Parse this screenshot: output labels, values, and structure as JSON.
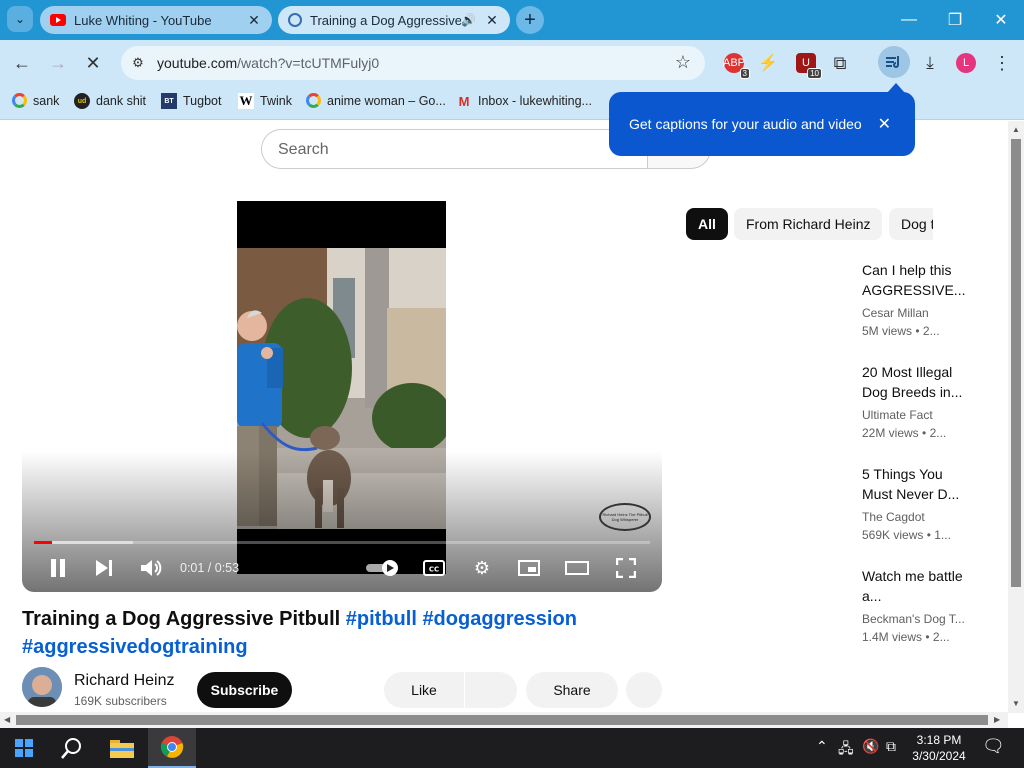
{
  "browser": {
    "tabs": [
      {
        "label": "Luke Whiting - YouTube"
      },
      {
        "label": "Training a Dog Aggressive Pitbull"
      }
    ],
    "url_host": "youtube.com",
    "url_path": "/watch?v=tcUTMFulyj0",
    "profile_initial": "L",
    "extensions": [
      {
        "name": "adblock-extension",
        "badge": "3"
      },
      {
        "name": "lightning-extension",
        "badge": ""
      },
      {
        "name": "shield-extension",
        "badge": "10"
      }
    ],
    "bookmarks": [
      {
        "label": "sank",
        "icon": "google-icon"
      },
      {
        "label": "dank shit",
        "icon": "ud-icon",
        "glyph": "ud"
      },
      {
        "label": "Tugbot",
        "icon": "bt-icon",
        "glyph": "BT"
      },
      {
        "label": "Twink",
        "icon": "w-icon",
        "glyph": "W"
      },
      {
        "label": "anime woman – Go...",
        "icon": "google-icon"
      },
      {
        "label": "Inbox - lukewhiting...",
        "icon": "gmail-icon",
        "glyph": "M"
      }
    ],
    "caption_popup": "Get captions for your audio and video"
  },
  "youtube": {
    "search_placeholder": "Search",
    "player": {
      "current_time": "0:01",
      "duration": "0:53",
      "time_display": "0:01 / 0:53",
      "progress_fraction": 0.03,
      "buffered_fraction": 0.16,
      "watermark": "Richard Heinz The Pitbull Dog Whisperer"
    },
    "video": {
      "title": "Training a Dog Aggressive Pitbull",
      "hashtags": [
        "#pitbull",
        "#dogaggression",
        "#aggressivedogtraining"
      ]
    },
    "channel": {
      "name": "Richard Heinz",
      "subscribers": "169K subscribers",
      "subscribe_label": "Subscribe"
    },
    "actions": {
      "like": "Like",
      "share": "Share"
    },
    "chips": [
      "All",
      "From Richard Heinz",
      "Dog t"
    ],
    "recommendations": [
      {
        "title": "Can I help this AGGRESSIVE...",
        "channel": "Cesar Millan",
        "views": "5M views",
        "age": "• 2..."
      },
      {
        "title": "20 Most Illegal Dog Breeds in...",
        "channel": "Ultimate Fact",
        "views": "22M views",
        "age": "• 2..."
      },
      {
        "title": "5 Things You Must Never D...",
        "channel": "The Cagdot",
        "views": "569K views",
        "age": "• 1..."
      },
      {
        "title": "Watch me battle a...",
        "channel": "Beckman's Dog T...",
        "views": "1.4M views",
        "age": "• 2..."
      }
    ]
  },
  "taskbar": {
    "time": "3:18 PM",
    "date": "3/30/2024"
  },
  "colors": {
    "titlebar": "#2196d3",
    "toolbar": "#cde7f8",
    "popup": "#0b57d0",
    "progress": "#ff0000",
    "link": "#065fd4"
  }
}
